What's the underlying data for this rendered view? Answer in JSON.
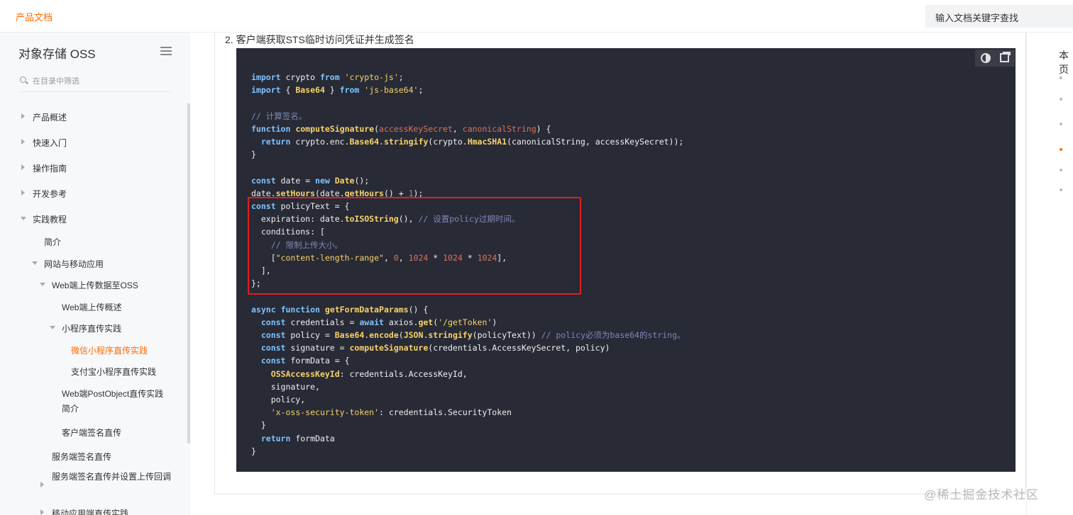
{
  "topbar": {
    "brand": "产品文档",
    "search_placeholder": "输入文档关键字查找"
  },
  "sidebar": {
    "title": "对象存储 OSS",
    "filter_placeholder": "在目录中筛选",
    "items": [
      {
        "label": "产品概述",
        "state": "collapsed"
      },
      {
        "label": "快速入门",
        "state": "collapsed"
      },
      {
        "label": "操作指南",
        "state": "collapsed"
      },
      {
        "label": "开发参考",
        "state": "collapsed"
      },
      {
        "label": "实践教程",
        "state": "expanded"
      },
      {
        "label": "简介",
        "state": "leaf"
      },
      {
        "label": "网站与移动应用",
        "state": "expanded"
      },
      {
        "label": "Web端上传数据至OSS",
        "state": "expanded"
      },
      {
        "label": "Web端上传概述",
        "state": "leaf"
      },
      {
        "label": "小程序直传实践",
        "state": "expanded"
      },
      {
        "label": "微信小程序直传实践",
        "state": "active"
      },
      {
        "label": "支付宝小程序直传实践",
        "state": "leaf"
      },
      {
        "label": "Web端PostObject直传实践简介",
        "state": "leaf"
      },
      {
        "label": "客户端签名直传",
        "state": "leaf"
      },
      {
        "label": "服务端签名直传",
        "state": "leaf"
      },
      {
        "label": "服务端签名直传并设置上传回调",
        "state": "collapsed"
      },
      {
        "label": "移动应用端直传实践",
        "state": "collapsed"
      }
    ]
  },
  "main": {
    "heading": "2. 客户端获取STS临时访问凭证并生成签名",
    "code_language": "javascript",
    "code_lines": [
      "import crypto from 'crypto-js';",
      "import { Base64 } from 'js-base64';",
      "",
      "// 计算签名。",
      "function computeSignature(accessKeySecret, canonicalString) {",
      "  return crypto.enc.Base64.stringify(crypto.HmacSHA1(canonicalString, accessKeySecret));",
      "}",
      "",
      "const date = new Date();",
      "date.setHours(date.getHours() + 1);",
      "const policyText = {",
      "  expiration: date.toISOString(), // 设置policy过期时间。",
      "  conditions: [",
      "    // 限制上传大小。",
      "    [\"content-length-range\", 0, 1024 * 1024 * 1024],",
      "  ],",
      "};",
      "",
      "async function getFormDataParams() {",
      "  const credentials = await axios.get('/getToken')",
      "  const policy = Base64.encode(JSON.stringify(policyText)) // policy必须为base64的string。",
      "  const signature = computeSignature(credentials.AccessKeySecret, policy)",
      "  const formData = {",
      "    OSSAccessKeyId: credentials.AccessKeyId,",
      "    signature,",
      "    policy,",
      "    'x-oss-security-token': credentials.SecurityToken",
      "  }",
      "  return formData",
      "}"
    ]
  },
  "right_panel": {
    "title": "本页"
  },
  "watermark": "@稀土掘金技术社区",
  "colors": {
    "accent": "#ff6a00",
    "code_bg": "#282a36",
    "highlight_border": "#e02020"
  }
}
